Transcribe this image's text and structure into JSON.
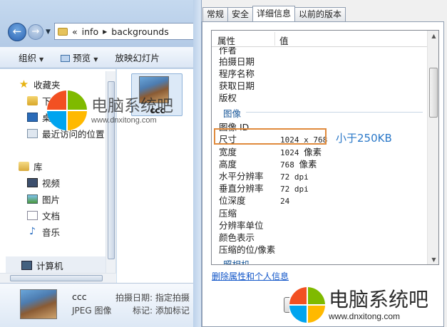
{
  "explorer": {
    "breadcrumb_prefix": "«",
    "breadcrumb": [
      "info",
      "backgrounds"
    ],
    "toolbar": {
      "organize": "组织",
      "preview": "预览",
      "slideshow": "放映幻灯片"
    },
    "nav": {
      "favorites": "收藏夹",
      "downloads": "下载",
      "desktop": "桌面",
      "recent": "最近访问的位置",
      "libraries": "库",
      "videos": "视频",
      "pictures": "图片",
      "documents": "文档",
      "music": "音乐",
      "computer": "计算机"
    },
    "file": {
      "name": "ccc",
      "type": "JPEG 图像",
      "date_label": "拍摄日期: 指定拍摄",
      "tags_label": "标记: 添加标记"
    }
  },
  "dialog": {
    "tabs": [
      "常规",
      "安全",
      "详细信息",
      "以前的版本"
    ],
    "active_tab": "详细信息",
    "columns": {
      "property": "属性",
      "value": "值"
    },
    "top_rows": [
      {
        "key": "作者",
        "value": ""
      },
      {
        "key": "拍摄日期",
        "value": ""
      },
      {
        "key": "程序名称",
        "value": ""
      },
      {
        "key": "获取日期",
        "value": ""
      },
      {
        "key": "版权",
        "value": ""
      }
    ],
    "group_image": "图像",
    "image_rows": [
      {
        "key": "图像 ID",
        "value": "",
        "unit": ""
      },
      {
        "key": "尺寸",
        "value": "1024 x 768",
        "unit": ""
      },
      {
        "key": "宽度",
        "value": "1024",
        "unit": "像素"
      },
      {
        "key": "高度",
        "value": "768",
        "unit": "像素"
      },
      {
        "key": "水平分辨率",
        "value": "72 dpi",
        "unit": ""
      },
      {
        "key": "垂直分辨率",
        "value": "72 dpi",
        "unit": ""
      },
      {
        "key": "位深度",
        "value": "24",
        "unit": ""
      },
      {
        "key": "压缩",
        "value": "",
        "unit": ""
      },
      {
        "key": "分辨率单位",
        "value": "",
        "unit": ""
      },
      {
        "key": "颜色表示",
        "value": "",
        "unit": ""
      },
      {
        "key": "压缩的位/像素",
        "value": "",
        "unit": ""
      }
    ],
    "group_camera": "照相机",
    "remove_link": "删除属性和个人信息",
    "annotation": "小于250KB",
    "highlight_color": "#e08a3c",
    "annotation_color": "#2a78c8"
  },
  "watermark": {
    "title": "电脑系统吧",
    "url": "www.dnxitong.com",
    "logo_colors": [
      "#f25022",
      "#7fba00",
      "#00a4ef",
      "#ffb900"
    ]
  }
}
